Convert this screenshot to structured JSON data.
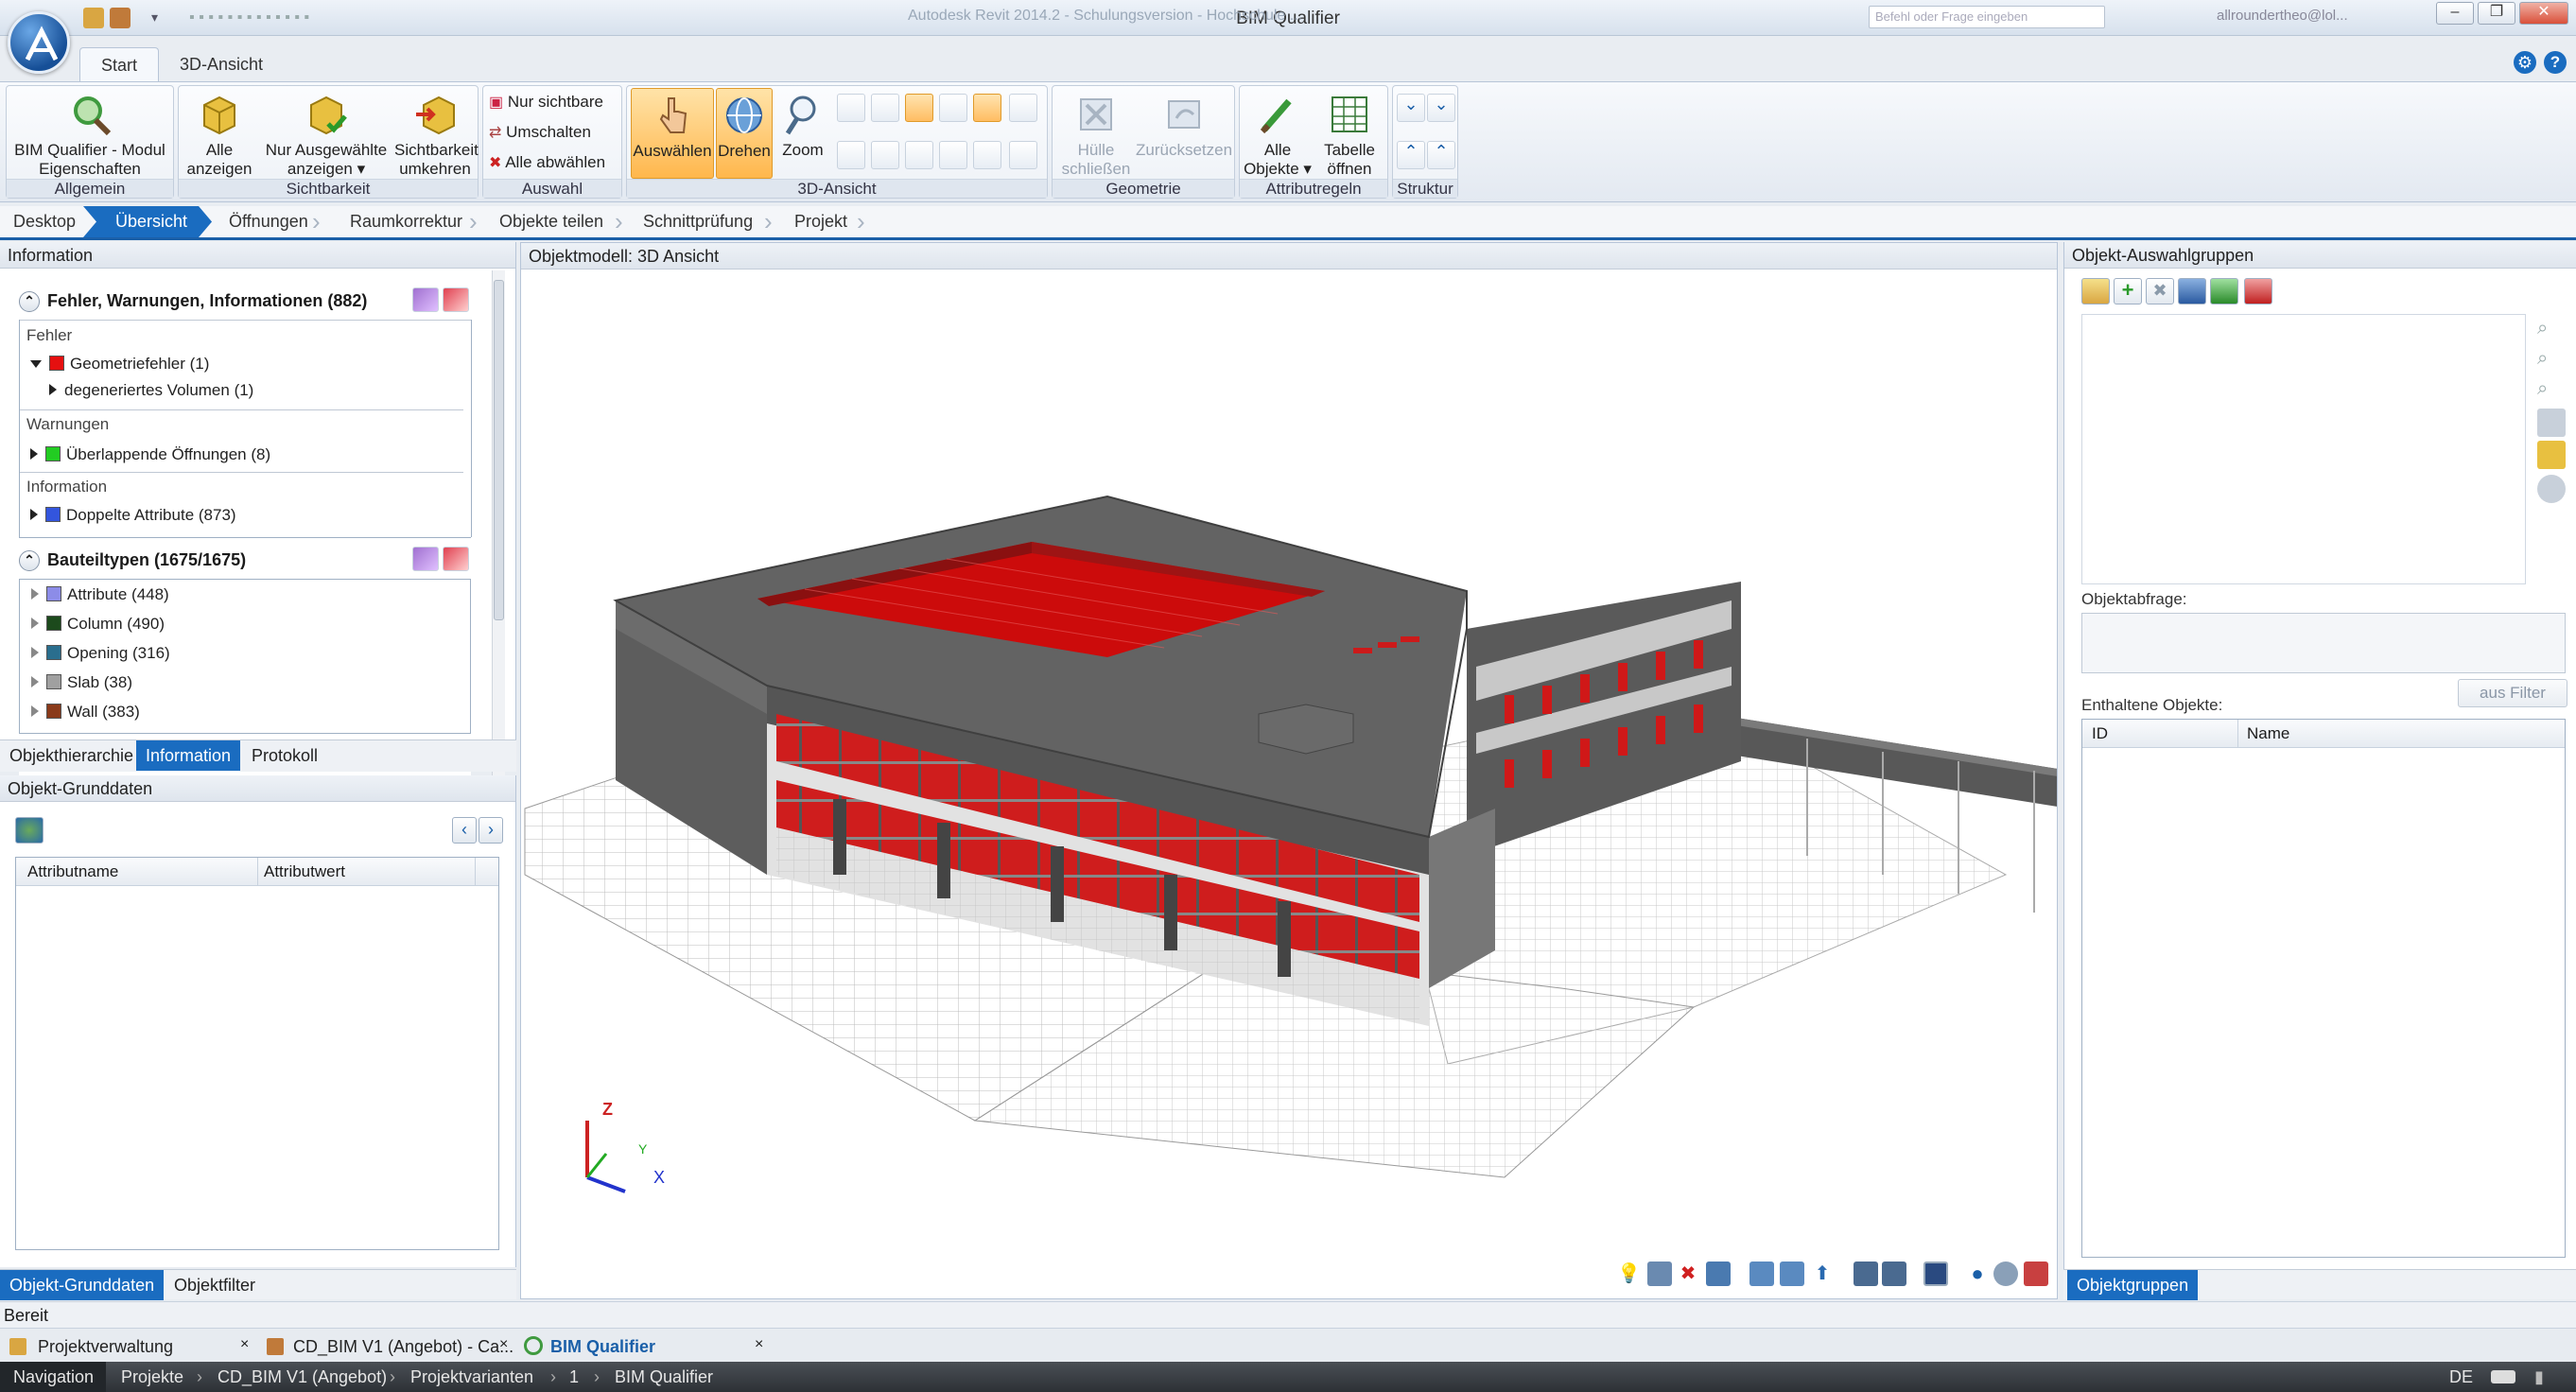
{
  "window": {
    "title": "BIM Qualifier",
    "blurred_left": "Autodesk Revit 2014.2 - Schulungsversion - Hochschule ...",
    "blurred_right": "Befehl oder Frage eingeben",
    "user": "allroundertheo@lol..."
  },
  "ribbon_tabs": [
    "Start",
    "3D-Ansicht"
  ],
  "ribbon": {
    "allgemein": {
      "label": "Allgemein",
      "btn": "BIM Qualifier - Modul Eigenschaften"
    },
    "sichtbarkeit": {
      "label": "Sichtbarkeit",
      "b1": "Alle anzeigen",
      "b2": "Nur Ausgewählte anzeigen",
      "b3": "Sichtbarkeit umkehren"
    },
    "auswahl": {
      "label": "Auswahl",
      "i1": "Nur sichtbare",
      "i2": "Umschalten",
      "i3": "Alle abwählen"
    },
    "ansicht3d": {
      "label": "3D-Ansicht",
      "b1": "Auswählen",
      "b2": "Drehen",
      "b3": "Zoom"
    },
    "geometrie": {
      "label": "Geometrie",
      "b1": "Hülle schließen",
      "b2": "Zurücksetzen"
    },
    "attributregeln": {
      "label": "Attributregeln",
      "b1": "Alle Objekte",
      "b2": "Tabelle öffnen"
    },
    "struktur": {
      "label": "Struktur"
    }
  },
  "breadcrumbs": [
    "Desktop",
    "Übersicht",
    "Öffnungen",
    "Raumkorrektur",
    "Objekte teilen",
    "Schnittprüfung",
    "Projekt"
  ],
  "left": {
    "title": "Information",
    "errors_header": "Fehler, Warnungen, Informationen (882)",
    "fehler_label": "Fehler",
    "fehler_item": "Geometriefehler (1)",
    "fehler_sub": "degeneriertes Volumen (1)",
    "warn_label": "Warnungen",
    "warn_item": "Überlappende Öffnungen (8)",
    "info_label": "Information",
    "info_item": "Doppelte Attribute (873)",
    "types_header": "Bauteiltypen (1675/1675)",
    "types": [
      {
        "label": "Attribute (448)",
        "color": "#8c8ce8"
      },
      {
        "label": "Column (490)",
        "color": "#1c4a1c"
      },
      {
        "label": "Opening (316)",
        "color": "#2a6e8e"
      },
      {
        "label": "Slab (38)",
        "color": "#a0a0a0"
      },
      {
        "label": "Wall (383)",
        "color": "#8a3a1a"
      }
    ],
    "subtabs": [
      "Objekthierarchie",
      "Information",
      "Protokoll"
    ],
    "grund_title": "Objekt-Grunddaten",
    "col1": "Attributname",
    "col2": "Attributwert",
    "bottom_tabs": [
      "Objekt-Grunddaten",
      "Objektfilter"
    ]
  },
  "center": {
    "title": "Objektmodell: 3D Ansicht",
    "axis_z": "Z",
    "axis_y": "Y",
    "axis_x": "X"
  },
  "right": {
    "title": "Objekt-Auswahlgruppen",
    "query_label": "Objektabfrage:",
    "filter_btn": "aus Filter",
    "contained_label": "Enthaltene Objekte:",
    "col_id": "ID",
    "col_name": "Name",
    "bottom_tab": "Objektgruppen"
  },
  "status": "Bereit",
  "taskbar": [
    "Projektverwaltung",
    "CD_BIM V1 (Angebot) - Ca...",
    "BIM Qualifier"
  ],
  "nav": {
    "label": "Navigation",
    "path": [
      "Projekte",
      "CD_BIM V1 (Angebot)",
      "Projektvarianten",
      "1",
      "BIM Qualifier"
    ],
    "lang": "DE"
  },
  "colors": {
    "accent": "#1a6cc0",
    "error": "#e51010",
    "warning": "#22cc22",
    "info": "#3355dd"
  }
}
